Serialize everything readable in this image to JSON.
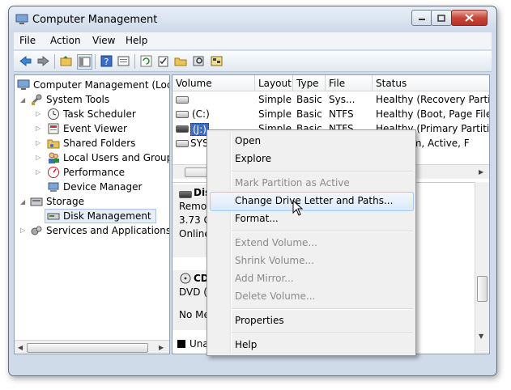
{
  "window": {
    "title": "Computer Management"
  },
  "menubar": {
    "items": [
      "File",
      "Action",
      "View",
      "Help"
    ]
  },
  "tree": {
    "root": "Computer Management (Local",
    "system_tools": "System Tools",
    "children": [
      "Task Scheduler",
      "Event Viewer",
      "Shared Folders",
      "Local Users and Groups",
      "Performance",
      "Device Manager"
    ],
    "storage": "Storage",
    "disk_management": "Disk Management",
    "services": "Services and Applications"
  },
  "volumes": {
    "columns": [
      "Volume",
      "Layout",
      "Type",
      "File Sys...",
      "Status"
    ],
    "rows": [
      {
        "volume": "",
        "layout": "Simple",
        "type": "Basic",
        "fs": "",
        "status": "Healthy (Recovery Partitic"
      },
      {
        "volume": "(C:)",
        "layout": "Simple",
        "type": "Basic",
        "fs": "NTFS",
        "status": "Healthy (Boot, Page File, ("
      },
      {
        "volume": "(J:)",
        "layout": "Simple",
        "type": "Basic",
        "fs": "NTFS",
        "status": "Healthy (Primary Partitior"
      },
      {
        "volume": "SYST",
        "layout": "",
        "type": "",
        "fs": "",
        "status": "(System, Active, F"
      }
    ]
  },
  "disks": {
    "disk1": {
      "name": "Dis",
      "line1": "Remov",
      "line2": "3.73 G",
      "line3": "Online"
    },
    "cd": {
      "name": "CD",
      "line1": "DVD (E",
      "line2": "No Me"
    },
    "legend": "Una"
  },
  "context_menu": {
    "items": [
      "Open",
      "Explore",
      "Mark Partition as Active",
      "Change Drive Letter and Paths...",
      "Format...",
      "Extend Volume...",
      "Shrink Volume...",
      "Add Mirror...",
      "Delete Volume...",
      "Properties",
      "Help"
    ],
    "highlighted": "Change Drive Letter and Paths..."
  },
  "colors": {
    "accent": "#3a6ea5",
    "selection": "#e5eef9",
    "close": "#c7463a"
  }
}
